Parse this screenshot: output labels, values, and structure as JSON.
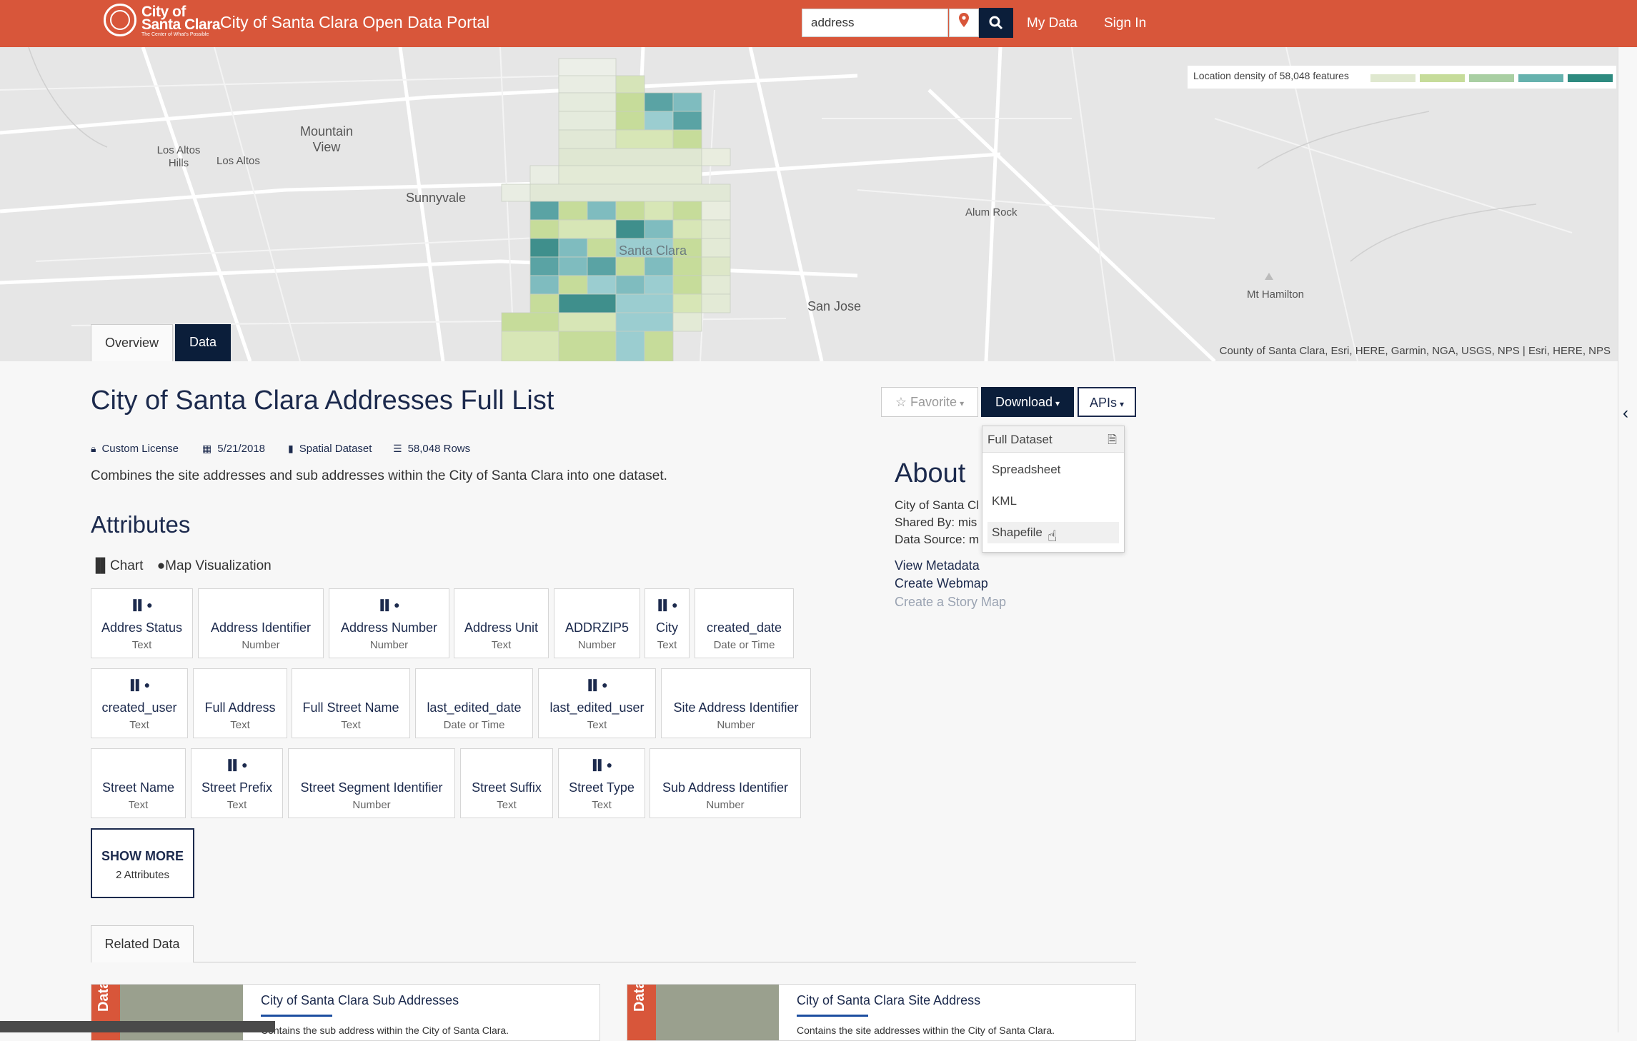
{
  "header": {
    "logo_word_1": "City of",
    "logo_word_2": "Santa Clara",
    "logo_tagline": "The Center of What's Possible",
    "site_title": "City of Santa Clara Open Data Portal",
    "search_value": "address",
    "my_data": "My Data",
    "sign_in": "Sign In"
  },
  "map": {
    "places": {
      "los_altos_hills": "Los Altos Hills",
      "los_altos": "Los Altos",
      "mountain_view": "Mountain View",
      "sunnyvale": "Sunnyvale",
      "santa_clara": "Santa Clara",
      "alum_rock": "Alum Rock",
      "san_jose": "San Jose",
      "mt_hamilton": "Mt Hamilton"
    },
    "legend_label": "Location density of 58,048 features",
    "legend_colors": [
      "#dfe8cf",
      "#c6dc9a",
      "#a9cfa3",
      "#66b2ae",
      "#2e8b80"
    ],
    "attribution": "County of Santa Clara, Esri, HERE, Garmin, NGA, USGS, NPS | Esri, HERE, NPS"
  },
  "tabs": {
    "overview": "Overview",
    "data": "Data"
  },
  "dataset": {
    "title": "City of Santa Clara Addresses Full List",
    "license": "Custom License",
    "date": "5/21/2018",
    "type": "Spatial Dataset",
    "rows": "58,048 Rows",
    "description": "Combines the site addresses and sub addresses within the City of Santa Clara into one dataset."
  },
  "actions": {
    "favorite": "Favorite",
    "download": "Download",
    "apis": "APIs"
  },
  "download_menu": {
    "header": "Full Dataset",
    "items": [
      "Spreadsheet",
      "KML",
      "Shapefile"
    ]
  },
  "attributes": {
    "heading": "Attributes",
    "chart_link": "Chart",
    "map_link": "Map Visualization",
    "cards": [
      {
        "name": "Addres Status",
        "type": "Text"
      },
      {
        "name": "Address Identifier",
        "type": "Number"
      },
      {
        "name": "Address Number",
        "type": "Number"
      },
      {
        "name": "Address Unit",
        "type": "Text"
      },
      {
        "name": "ADDRZIP5",
        "type": "Number"
      },
      {
        "name": "City",
        "type": "Text"
      },
      {
        "name": "created_date",
        "type": "Date or Time"
      },
      {
        "name": "created_user",
        "type": "Text"
      },
      {
        "name": "Full Address",
        "type": "Text"
      },
      {
        "name": "Full Street Name",
        "type": "Text"
      },
      {
        "name": "last_edited_date",
        "type": "Date or Time"
      },
      {
        "name": "last_edited_user",
        "type": "Text"
      },
      {
        "name": "Site Address Identifier",
        "type": "Number"
      },
      {
        "name": "Street Name",
        "type": "Text"
      },
      {
        "name": "Street Prefix",
        "type": "Text"
      },
      {
        "name": "Street Segment Identifier",
        "type": "Number"
      },
      {
        "name": "Street Suffix",
        "type": "Text"
      },
      {
        "name": "Street Type",
        "type": "Text"
      },
      {
        "name": "Sub Address Identifier",
        "type": "Number"
      }
    ],
    "show_more": "SHOW MORE",
    "show_more_count": "2 Attributes"
  },
  "about": {
    "heading": "About",
    "line1": "City of Santa Cl",
    "line2": "Shared By: mis",
    "line3": "Data Source: m",
    "view_metadata": "View Metadata",
    "create_webmap": "Create Webmap",
    "create_story_map": "Create a Story Map"
  },
  "related": {
    "tab": "Related Data",
    "flag": "Data",
    "cards": [
      {
        "title": "City of Santa Clara Sub Addresses",
        "desc": "Contains the sub address within the City of Santa Clara."
      },
      {
        "title": "City of Santa Clara Site Address",
        "desc": "Contains the site addresses within the City of Santa Clara."
      }
    ]
  }
}
